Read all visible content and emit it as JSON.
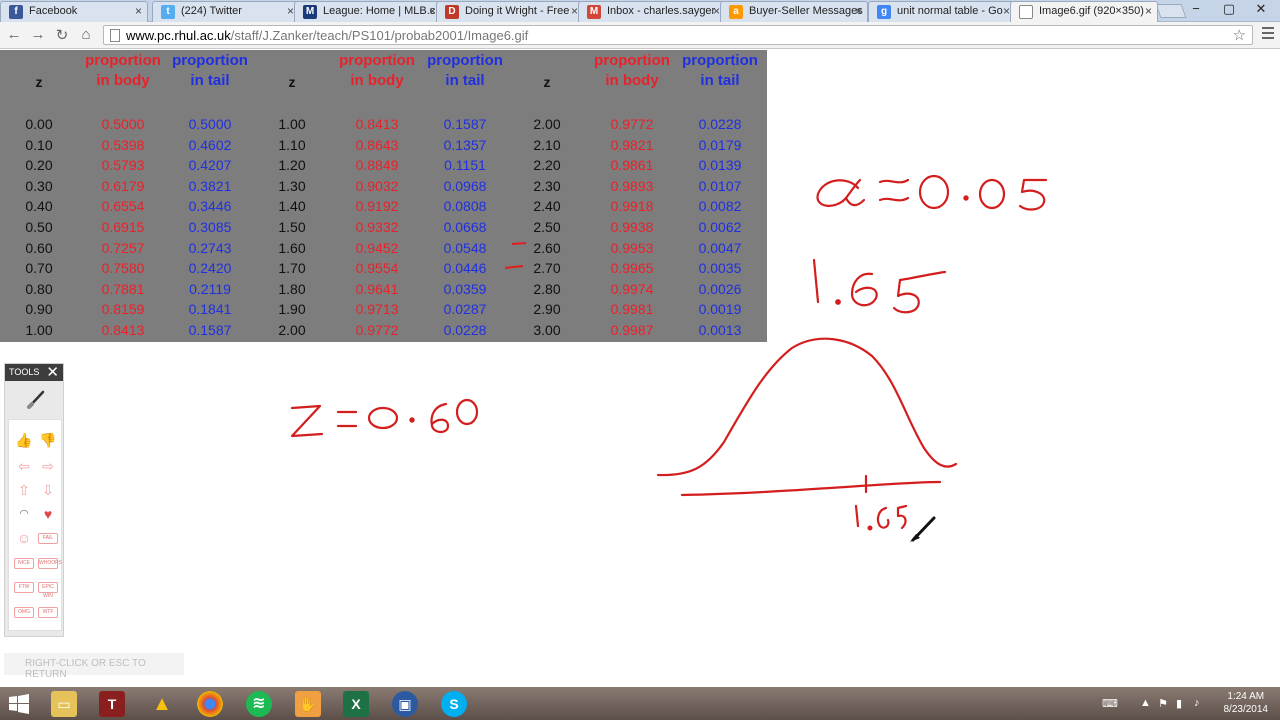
{
  "browser": {
    "tabs": [
      {
        "label": "Facebook",
        "icon": "facebook-icon",
        "color": "#3b5998",
        "glyph": "f"
      },
      {
        "label": "(224) Twitter",
        "icon": "twitter-icon",
        "color": "#55acee",
        "glyph": "t"
      },
      {
        "label": "League: Home | MLB.c",
        "icon": "mlb-icon",
        "color": "#1a3a7a",
        "glyph": "M"
      },
      {
        "label": "Doing it Wright - Free",
        "icon": "doc-icon",
        "color": "#c0392b",
        "glyph": "D"
      },
      {
        "label": "Inbox - charles.sayger",
        "icon": "gmail-icon",
        "color": "#d44638",
        "glyph": "M"
      },
      {
        "label": "Buyer-Seller Messages",
        "icon": "amazon-icon",
        "color": "#ff9900",
        "glyph": "a"
      },
      {
        "label": "unit normal table - Go",
        "icon": "google-icon",
        "color": "#4285f4",
        "glyph": "g"
      },
      {
        "label": "Image6.gif (920×350)",
        "icon": "page-icon",
        "color": "#ffffff",
        "glyph": ""
      }
    ],
    "url_host": "www.pc.rhul.ac.uk",
    "url_path": "/staff/J.Zanker/teach/PS101/probab2001/Image6.gif"
  },
  "table": {
    "headers": {
      "z": "z",
      "body_line1": "proportion",
      "body_line2": "in body",
      "tail_line1": "proportion",
      "tail_line2": "in tail"
    },
    "blocks": [
      {
        "z": [
          "0.00",
          "0.10",
          "0.20",
          "0.30",
          "0.40",
          "0.50",
          "0.60",
          "0.70",
          "0.80",
          "0.90",
          "1.00"
        ],
        "body": [
          "0.5000",
          "0.5398",
          "0.5793",
          "0.6179",
          "0.6554",
          "0.6915",
          "0.7257",
          "0.7580",
          "0.7881",
          "0.8159",
          "0.8413"
        ],
        "tail": [
          "0.5000",
          "0.4602",
          "0.4207",
          "0.3821",
          "0.3446",
          "0.3085",
          "0.2743",
          "0.2420",
          "0.2119",
          "0.1841",
          "0.1587"
        ]
      },
      {
        "z": [
          "1.00",
          "1.10",
          "1.20",
          "1.30",
          "1.40",
          "1.50",
          "1.60",
          "1.70",
          "1.80",
          "1.90",
          "2.00"
        ],
        "body": [
          "0.8413",
          "0.8643",
          "0.8849",
          "0.9032",
          "0.9192",
          "0.9332",
          "0.9452",
          "0.9554",
          "0.9641",
          "0.9713",
          "0.9772"
        ],
        "tail": [
          "0.1587",
          "0.1357",
          "0.1151",
          "0.0968",
          "0.0808",
          "0.0668",
          "0.0548",
          "0.0446",
          "0.0359",
          "0.0287",
          "0.0228"
        ]
      },
      {
        "z": [
          "2.00",
          "2.10",
          "2.20",
          "2.30",
          "2.40",
          "2.50",
          "2.60",
          "2.70",
          "2.80",
          "2.90",
          "3.00"
        ],
        "body": [
          "0.9772",
          "0.9821",
          "0.9861",
          "0.9893",
          "0.9918",
          "0.9938",
          "0.9953",
          "0.9965",
          "0.9974",
          "0.9981",
          "0.9987"
        ],
        "tail": [
          "0.0228",
          "0.0179",
          "0.0139",
          "0.0107",
          "0.0082",
          "0.0062",
          "0.0047",
          "0.0035",
          "0.0026",
          "0.0019",
          "0.0013"
        ]
      }
    ]
  },
  "tools_panel": {
    "title": "TOOLS",
    "stamps": [
      "NICE",
      "WHOOPS",
      "FTW",
      "EPIC WIN",
      "OMG",
      "WTF",
      "FAIL"
    ],
    "hint": "RIGHT-CLICK OR ESC TO RETURN"
  },
  "annotations": {
    "alpha": "α = 0.05",
    "critical": "1.65",
    "zvalue": "Z = 0.60",
    "axis_mark": "1.65"
  },
  "taskbar": {
    "time": "1:24 AM",
    "date": "8/23/2014"
  }
}
